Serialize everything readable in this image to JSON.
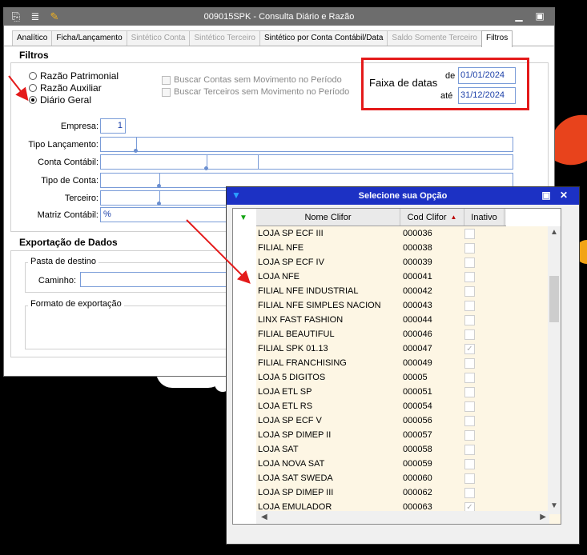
{
  "window": {
    "title": "009015SPK - Consulta Diário e Razão",
    "tabs": [
      "Analítico",
      "Ficha/Lançamento",
      "Sintético Conta",
      "Sintético Terceiro",
      "Sintético por Conta Contábil/Data",
      "Saldo Somente Terceiro",
      "Filtros"
    ]
  },
  "filters": {
    "section_title": "Filtros",
    "radios": [
      "Razão Patrimonial",
      "Razão Auxiliar",
      "Diário Geral"
    ],
    "selected_radio": "Diário Geral",
    "checkbox_no_movement_accounts": "Buscar Contas sem Movimento no Período",
    "checkbox_no_movement_third": "Buscar Terceiros sem Movimento no Período",
    "date_range": {
      "label": "Faixa de datas",
      "from_label": "de",
      "from_value": "01/01/2024",
      "to_label": "até",
      "to_value": "31/12/2024"
    },
    "fields": {
      "empresa_label": "Empresa:",
      "empresa_value": "1",
      "tipo_lancamento_label": "Tipo Lançamento:",
      "conta_contabil_label": "Conta Contábil:",
      "tipo_conta_label": "Tipo de Conta:",
      "terceiro_label": "Terceiro:",
      "matriz_contabil_label": "Matriz Contábil:",
      "matriz_contabil_value": "%"
    }
  },
  "export": {
    "section_title": "Exportação de Dados",
    "pasta_legend": "Pasta de destino",
    "caminho_label": "Caminho:",
    "formato_legend": "Formato de exportação"
  },
  "dialog": {
    "title": "Selecione sua Opção",
    "columns": [
      "Nome Clifor",
      "Cod Clifor",
      "Inativo"
    ],
    "rows": [
      {
        "name": "LOJA SP ECF III",
        "code": "000036",
        "inactive": false
      },
      {
        "name": "FILIAL NFE",
        "code": "000038",
        "inactive": false
      },
      {
        "name": "LOJA SP ECF IV",
        "code": "000039",
        "inactive": false
      },
      {
        "name": "LOJA NFE",
        "code": "000041",
        "inactive": false
      },
      {
        "name": "FILIAL NFE INDUSTRIAL",
        "code": "000042",
        "inactive": false
      },
      {
        "name": "FILIAL NFE SIMPLES NACION",
        "code": "000043",
        "inactive": false
      },
      {
        "name": "LINX FAST FASHION",
        "code": "000044",
        "inactive": false
      },
      {
        "name": "FILIAL BEAUTIFUL",
        "code": "000046",
        "inactive": false
      },
      {
        "name": "FILIAL SPK 01.13",
        "code": "000047",
        "inactive": true
      },
      {
        "name": "FILIAL FRANCHISING",
        "code": "000049",
        "inactive": false
      },
      {
        "name": "LOJA 5 DIGITOS",
        "code": "00005",
        "inactive": false
      },
      {
        "name": "LOJA ETL SP",
        "code": "000051",
        "inactive": false
      },
      {
        "name": "LOJA ETL RS",
        "code": "000054",
        "inactive": false
      },
      {
        "name": "LOJA SP ECF V",
        "code": "000056",
        "inactive": false
      },
      {
        "name": "LOJA SP DIMEP II",
        "code": "000057",
        "inactive": false
      },
      {
        "name": "LOJA SAT",
        "code": "000058",
        "inactive": false
      },
      {
        "name": "LOJA NOVA SAT",
        "code": "000059",
        "inactive": false
      },
      {
        "name": "LOJA SAT SWEDA",
        "code": "000060",
        "inactive": false
      },
      {
        "name": "LOJA SP DIMEP III",
        "code": "000062",
        "inactive": false
      },
      {
        "name": "LOJA EMULADOR",
        "code": "000063",
        "inactive": true
      }
    ]
  },
  "colors": {
    "titlebar": "#6d6d6d",
    "dialog_title": "#1c31c4",
    "highlight": "#e41a1a",
    "grid_body": "#fdf6e4",
    "input_text": "#1b3fa8"
  }
}
